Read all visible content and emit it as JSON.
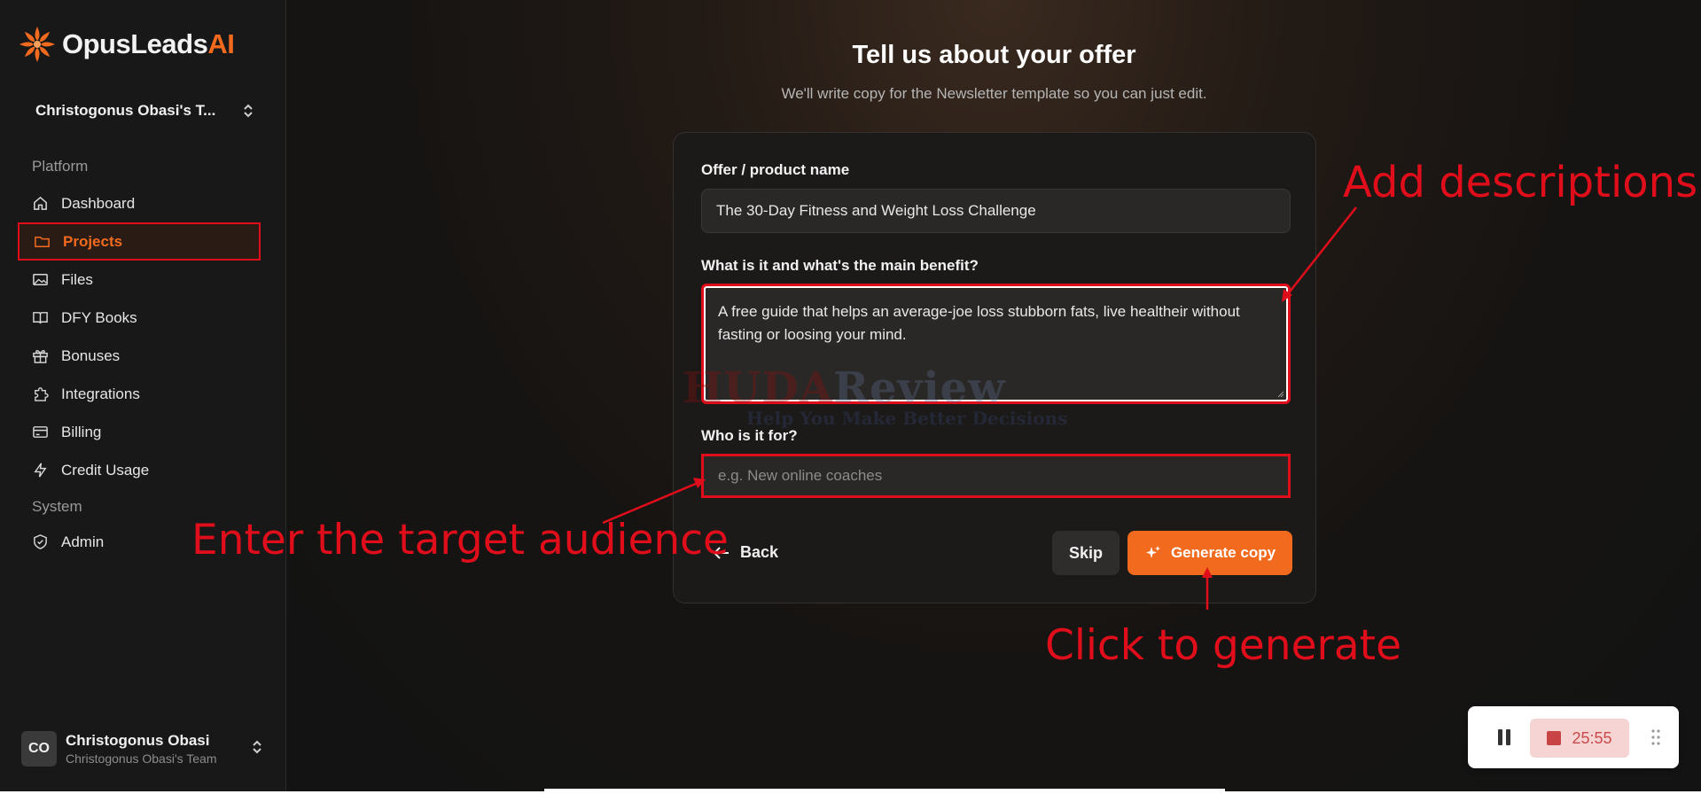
{
  "brand": {
    "name_main": "OpusLeads",
    "name_accent": "AI",
    "accent_color": "#f26a1e"
  },
  "sidebar": {
    "team": "Christogonus Obasi's T...",
    "section_platform": "Platform",
    "section_system": "System",
    "items": [
      {
        "label": "Dashboard",
        "icon": "home-icon"
      },
      {
        "label": "Projects",
        "icon": "folder-icon",
        "active": true
      },
      {
        "label": "Files",
        "icon": "image-icon"
      },
      {
        "label": "DFY Books",
        "icon": "book-icon"
      },
      {
        "label": "Bonuses",
        "icon": "gift-icon"
      },
      {
        "label": "Integrations",
        "icon": "puzzle-icon"
      },
      {
        "label": "Billing",
        "icon": "credit-card-icon"
      },
      {
        "label": "Credit Usage",
        "icon": "lightning-icon"
      }
    ],
    "system_items": [
      {
        "label": "Admin",
        "icon": "shield-icon"
      }
    ],
    "user": {
      "initials": "CO",
      "name": "Christogonus Obasi",
      "team": "Christogonus Obasi's Team"
    }
  },
  "main": {
    "title": "Tell us about your offer",
    "subtitle": "We'll write copy for the Newsletter template so you can just edit.",
    "form": {
      "offer_label": "Offer / product name",
      "offer_value": "The 30-Day Fitness and Weight Loss Challenge",
      "benefit_label": "What is it and what's the main benefit?",
      "benefit_value": "A free guide that helps an average-joe loss stubborn fats, live healtheir without fasting or loosing your mind.",
      "audience_label": "Who is it for?",
      "audience_placeholder": "e.g. New online coaches",
      "back_label": "Back",
      "skip_label": "Skip",
      "generate_label": "Generate copy"
    }
  },
  "annotations": {
    "add_descriptions": "Add descriptions",
    "enter_audience": "Enter the target audience",
    "click_generate": "Click to generate",
    "color": "#e00d1b"
  },
  "watermark": {
    "brand_red": "HUDA",
    "brand_blue": "Review",
    "tagline": "Help You Make Better Decisions"
  },
  "recorder": {
    "time": "25:55"
  }
}
